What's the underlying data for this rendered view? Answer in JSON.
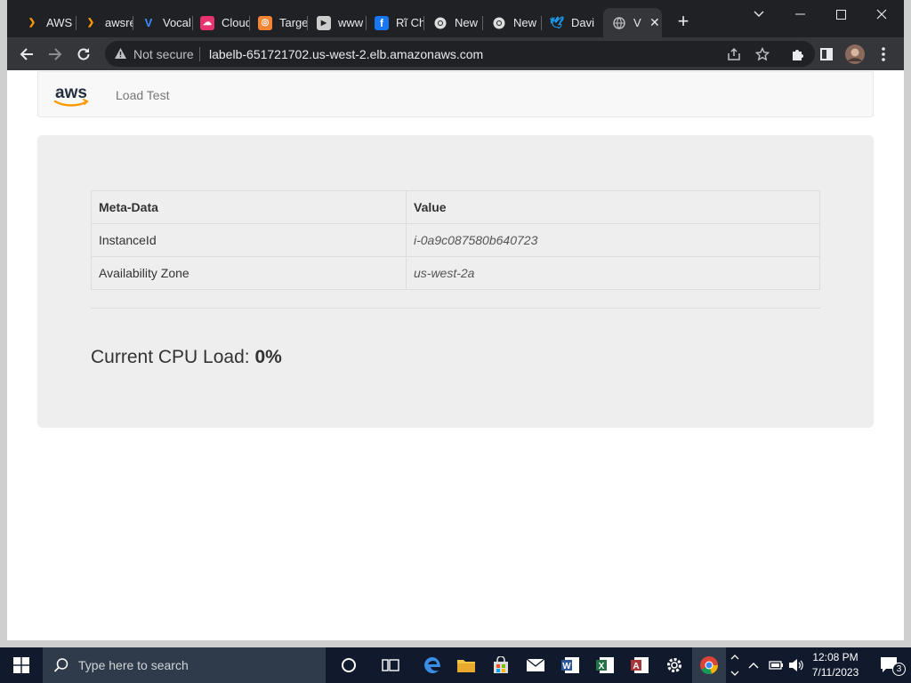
{
  "browser": {
    "tabs": [
      {
        "title": "AWS",
        "icon": "aws-icon",
        "color": "#ff9900"
      },
      {
        "title": "awsre",
        "icon": "aws-icon",
        "color": "#ff9900"
      },
      {
        "title": "Vocal",
        "icon": "vocareum-icon",
        "color": "#3d8bff"
      },
      {
        "title": "Cloud",
        "icon": "cloud-icon",
        "color": "#e8336e"
      },
      {
        "title": "Targe",
        "icon": "target-icon",
        "color": "#f58534"
      },
      {
        "title": "www",
        "icon": "youtube-icon",
        "color": "#cccccc"
      },
      {
        "title": "Rĩ Ch",
        "icon": "facebook-icon",
        "color": "#1877f2"
      },
      {
        "title": "New",
        "icon": "chrome-icon",
        "color": "#cccccc"
      },
      {
        "title": "New",
        "icon": "chrome-icon",
        "color": "#cccccc"
      },
      {
        "title": "Davi",
        "icon": "twitter-icon",
        "color": "#1d9bf0"
      },
      {
        "title": "V",
        "icon": "globe-icon",
        "color": "#cccccc",
        "active": true
      }
    ],
    "security_label": "Not secure",
    "url": "labelb-651721702.us-west-2.elb.amazonaws.com"
  },
  "page": {
    "logo_text": "aws",
    "brand": "Load Test",
    "table": {
      "headers": [
        "Meta-Data",
        "Value"
      ],
      "rows": [
        {
          "key": "InstanceId",
          "value": "i-0a9c087580b640723"
        },
        {
          "key": "Availability Zone",
          "value": "us-west-2a"
        }
      ]
    },
    "cpu_label": "Current CPU Load:",
    "cpu_value": "0%"
  },
  "taskbar": {
    "search_placeholder": "Type here to search",
    "time": "12:08 PM",
    "date": "7/11/2023",
    "notification_count": "3"
  }
}
